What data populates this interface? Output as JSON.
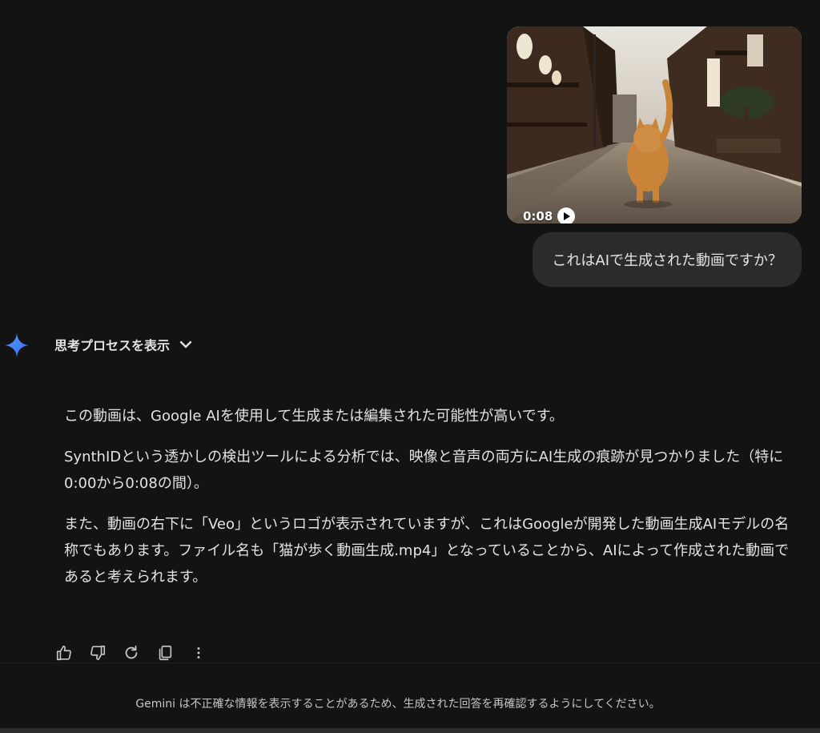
{
  "conversation": {
    "user": {
      "video": {
        "duration": "0:08",
        "play_icon": "play-icon"
      },
      "message": "これはAIで生成された動画ですか？"
    },
    "model": {
      "avatar_icon": "gemini-sparkle-icon",
      "thinking_toggle_label": "思考プロセスを表示",
      "paragraphs": [
        "この動画は、Google AIを使用して生成または編集された可能性が高いです。",
        "SynthIDという透かしの検出ツールによる分析では、映像と音声の両方にAI生成の痕跡が見つかりました（特に0:00から0:08の間）。",
        "また、動画の右下に「Veo」というロゴが表示されていますが、これはGoogleが開発した動画生成AIモデルの名称でもあります。ファイル名も「猫が歩く動画生成.mp4」となっていることから、AIによって作成された動画であると考えられます。"
      ],
      "actions": [
        "thumbs-up-icon",
        "thumbs-down-icon",
        "regenerate-icon",
        "copy-icon",
        "more-icon"
      ]
    }
  },
  "footer": {
    "disclaimer": "Gemini は不正確な情報を表示することがあるため、生成された回答を再確認するようにしてください。"
  },
  "colors": {
    "background": "#131314",
    "bubble": "#2a2b2d",
    "text": "#e3e3e3",
    "accent": "#4285f4"
  }
}
